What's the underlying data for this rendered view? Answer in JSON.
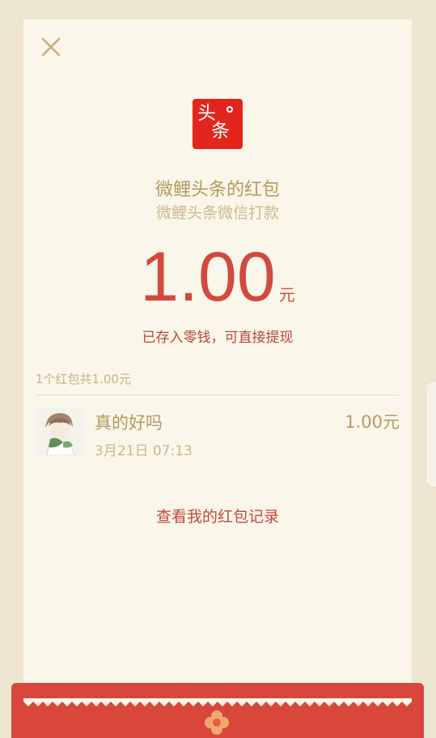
{
  "header": {
    "close_icon": "close-icon",
    "logo_glyph_top": "头",
    "logo_glyph_bottom": "条",
    "sender": "微鲤头条的红包",
    "subtitle": "微鲤头条微信打款"
  },
  "amount": {
    "value": "1.00",
    "unit": "元",
    "note": "已存入零钱，可直接提现"
  },
  "summary": "1个红包共1.00元",
  "record": {
    "name": "真的好吗",
    "time": "3月21日  07:13",
    "amount": "1.00元",
    "avatar_icon": "avatar"
  },
  "link": "查看我的红包记录",
  "colors": {
    "background": "#efe6d2",
    "card": "#fbf6ea",
    "accent_red": "#d2493e",
    "gold_text": "#b39a5f",
    "logo_red": "#e2261d"
  }
}
